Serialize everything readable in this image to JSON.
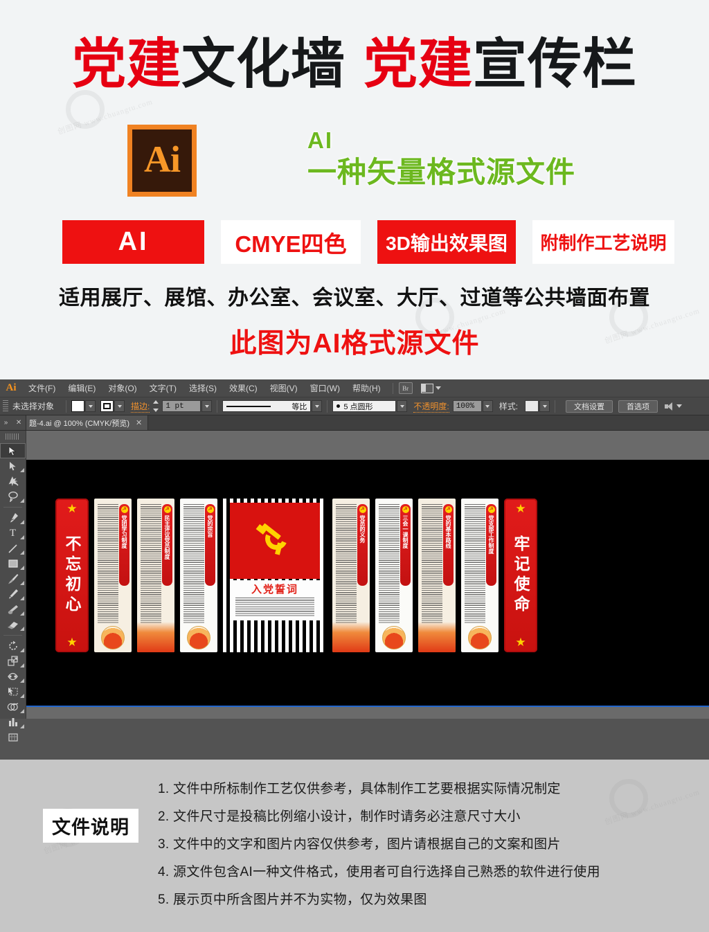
{
  "promo": {
    "title_parts": [
      {
        "text": "党建",
        "color": "red"
      },
      {
        "text": "文化墙",
        "color": "black"
      },
      {
        "text": "党建",
        "color": "red"
      },
      {
        "text": "宣传栏",
        "color": "black"
      }
    ],
    "ai_logo_text": "Ai",
    "green_ai": "AI",
    "green_sub": "一种矢量格式源文件",
    "badges": [
      {
        "label": "AI",
        "style": "solid-red"
      },
      {
        "label": "CMYE四色",
        "style": "white"
      },
      {
        "label": "3D输出效果图",
        "style": "solid-red"
      },
      {
        "label": "附制作工艺说明",
        "style": "white"
      }
    ],
    "scope_line": "适用展厅、展馆、办公室、会议室、大厅、过道等公共墙面布置",
    "note_line": "此图为AI格式源文件",
    "watermark_text": "创图网 www.chuangtu.com"
  },
  "app": {
    "logo": "Ai",
    "menus": [
      {
        "label": "文件(F)"
      },
      {
        "label": "编辑(E)"
      },
      {
        "label": "对象(O)"
      },
      {
        "label": "文字(T)"
      },
      {
        "label": "选择(S)"
      },
      {
        "label": "效果(C)"
      },
      {
        "label": "视图(V)"
      },
      {
        "label": "窗口(W)"
      },
      {
        "label": "帮助(H)"
      }
    ],
    "bridge_button": "Br",
    "control_bar": {
      "selection_status": "未选择对象",
      "stroke_label": "描边:",
      "stroke_weight": "1 pt",
      "profile": "等比",
      "brush": "5 点圆形",
      "opacity_label": "不透明度:",
      "opacity_value": "100%",
      "style_label": "样式:",
      "doc_setup_button": "文档设置",
      "preferences_button": "首选项"
    },
    "document_tab": {
      "title": "题-4.ai @ 100% (CMYK/预览)",
      "close": "✕"
    },
    "toolbox": {
      "tools": [
        {
          "name": "selection-tool",
          "glyph": "➤",
          "active": true
        },
        {
          "name": "direct-selection-tool",
          "glyph": "➤"
        },
        {
          "name": "magic-wand-tool",
          "glyph": "✳"
        },
        {
          "name": "lasso-tool",
          "glyph": "◠"
        },
        {
          "name": "pen-tool",
          "glyph": "✒"
        },
        {
          "name": "type-tool",
          "glyph": "T"
        },
        {
          "name": "line-segment-tool",
          "glyph": "╱"
        },
        {
          "name": "rectangle-tool",
          "glyph": "▢"
        },
        {
          "name": "paintbrush-tool",
          "glyph": "🖌"
        },
        {
          "name": "pencil-tool",
          "glyph": "✏"
        },
        {
          "name": "blob-brush-tool",
          "glyph": "◣"
        },
        {
          "name": "eraser-tool",
          "glyph": "▱"
        },
        {
          "name": "rotate-tool",
          "glyph": "↻"
        },
        {
          "name": "scale-tool",
          "glyph": "⧉"
        },
        {
          "name": "width-tool",
          "glyph": "⟆"
        },
        {
          "name": "free-transform-tool",
          "glyph": "⬓"
        },
        {
          "name": "shape-builder-tool",
          "glyph": "◉"
        },
        {
          "name": "column-graph-tool",
          "glyph": "▥"
        },
        {
          "name": "artboard-tool",
          "glyph": "▣"
        }
      ]
    },
    "artwork": {
      "left_banner": "不忘初心",
      "right_banner": "牢记使命",
      "center": {
        "oath_title": "入党誓词"
      },
      "panels": [
        {
          "tag": "党团学习制度",
          "bg": "cream",
          "foot": "circle"
        },
        {
          "tag": "民主评议党员制度",
          "bg": "cream",
          "foot": "water"
        },
        {
          "tag": "党的宗旨",
          "bg": "white",
          "foot": "circle"
        },
        {
          "tag": "党员的义务",
          "bg": "cream",
          "foot": "water"
        },
        {
          "tag": "三会一课制度",
          "bg": "white",
          "foot": "circle"
        },
        {
          "tag": "党的基本路线",
          "bg": "cream",
          "foot": "water"
        },
        {
          "tag": "党支部工作制度",
          "bg": "white",
          "foot": "circle"
        }
      ]
    }
  },
  "footer": {
    "label": "文件说明",
    "notes": [
      "1. 文件中所标制作工艺仅供参考，具体制作工艺要根据实际情况制定",
      "2. 文件尺寸是投稿比例缩小设计，制作时请务必注意尺寸大小",
      "3. 文件中的文字和图片内容仅供参考，图片请根据自己的文案和图片",
      "4. 源文件包含AI一种文件格式，使用者可自行选择自己熟悉的软件进行使用",
      "5. 展示页中所含图片并不为实物，仅为效果图"
    ]
  },
  "colors": {
    "brand_red": "#e60012",
    "badge_red": "#ee1111",
    "green": "#6cb81f",
    "ai_orange": "#f08222",
    "ai_brown": "#36190a",
    "app_chrome": "#4a4a4a",
    "canvas": "#000000",
    "footer_bg": "#c6c6c6"
  }
}
